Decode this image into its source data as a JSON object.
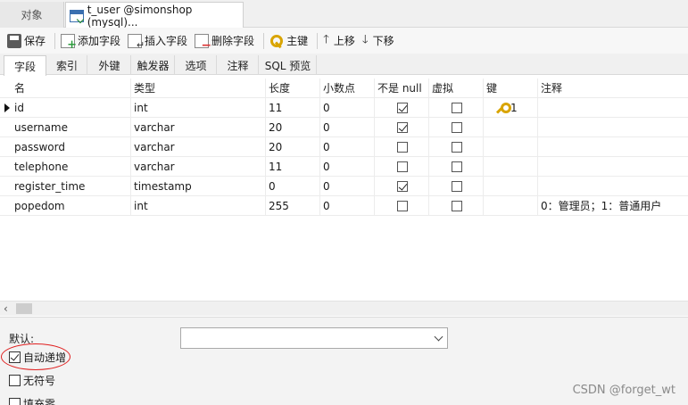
{
  "doc_tabs": {
    "objects": "对象",
    "table_tab": "t_user @simonshop (mysql)..."
  },
  "toolbar": {
    "save": "保存",
    "add_field": "添加字段",
    "insert_field": "插入字段",
    "delete_field": "删除字段",
    "primary_key": "主键",
    "move_up": "上移",
    "move_down": "下移"
  },
  "subtabs": [
    "字段",
    "索引",
    "外键",
    "触发器",
    "选项",
    "注释",
    "SQL 预览"
  ],
  "columns": [
    "名",
    "类型",
    "长度",
    "小数点",
    "不是 null",
    "虚拟",
    "键",
    "注释"
  ],
  "rows": [
    {
      "name": "id",
      "type": "int",
      "length": "11",
      "decimals": "0",
      "not_null": true,
      "virtual": false,
      "key": "1",
      "comment": ""
    },
    {
      "name": "username",
      "type": "varchar",
      "length": "20",
      "decimals": "0",
      "not_null": true,
      "virtual": false,
      "key": "",
      "comment": ""
    },
    {
      "name": "password",
      "type": "varchar",
      "length": "20",
      "decimals": "0",
      "not_null": false,
      "virtual": false,
      "key": "",
      "comment": ""
    },
    {
      "name": "telephone",
      "type": "varchar",
      "length": "11",
      "decimals": "0",
      "not_null": false,
      "virtual": false,
      "key": "",
      "comment": ""
    },
    {
      "name": "register_time",
      "type": "timestamp",
      "length": "0",
      "decimals": "0",
      "not_null": true,
      "virtual": false,
      "key": "",
      "comment": ""
    },
    {
      "name": "popedom",
      "type": "int",
      "length": "255",
      "decimals": "0",
      "not_null": false,
      "virtual": false,
      "key": "",
      "comment": "0：管理员；1：普通用户"
    }
  ],
  "bottom": {
    "default_label": "默认:",
    "auto_increment": {
      "label": "自动递增",
      "checked": true
    },
    "unsigned": {
      "label": "无符号",
      "checked": false
    },
    "zerofill": {
      "label": "填充零",
      "checked": false
    }
  },
  "watermark": "CSDN @forget_wt",
  "colors": {
    "highlight_oval": "#e02020",
    "key_icon": "#d9a400"
  }
}
